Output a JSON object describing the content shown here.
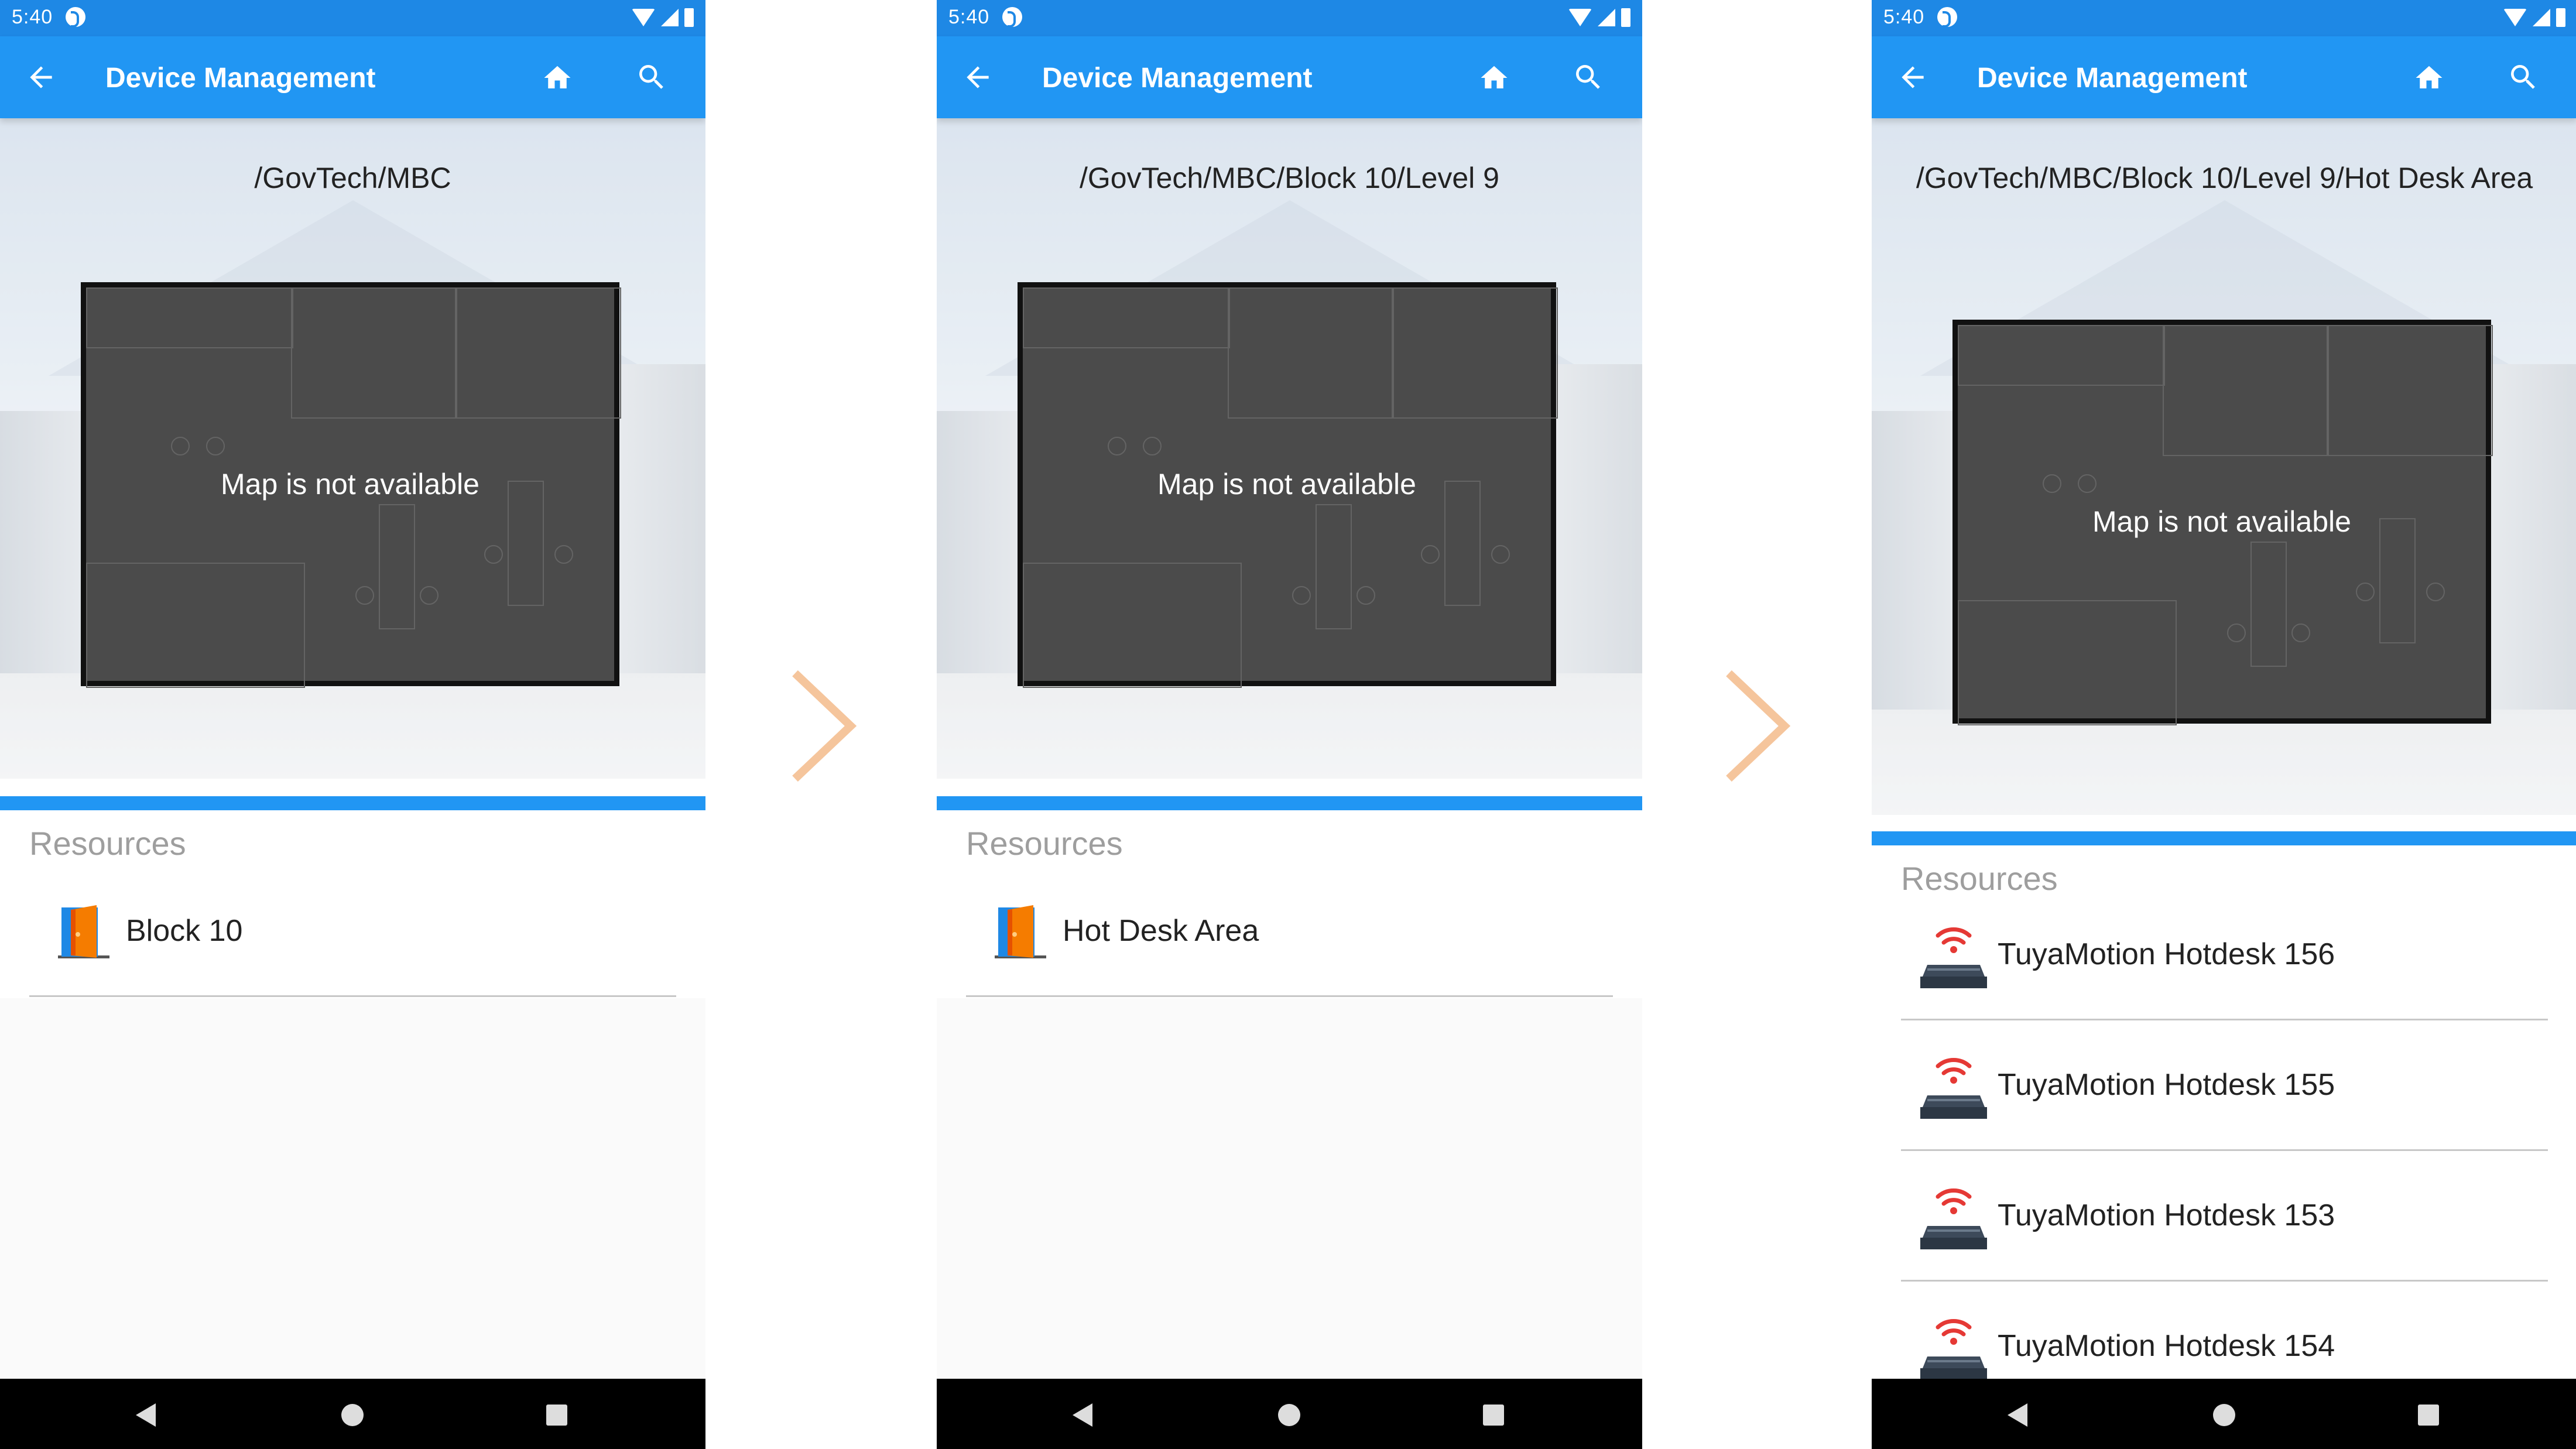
{
  "status_bar": {
    "time": "5:40"
  },
  "app_bar": {
    "title": "Device Management"
  },
  "screens": [
    {
      "breadcrumb": "/GovTech/MBC",
      "map_message": "Map is not available",
      "resources_heading": "Resources",
      "resources": [
        {
          "label": "Block 10",
          "icon": "door-icon"
        }
      ]
    },
    {
      "breadcrumb": "/GovTech/MBC/Block 10/Level 9",
      "map_message": "Map is not available",
      "resources_heading": "Resources",
      "resources": [
        {
          "label": "Hot Desk Area",
          "icon": "door-icon"
        }
      ]
    },
    {
      "breadcrumb": "/GovTech/MBC/Block 10/Level 9/Hot Desk Area",
      "map_message": "Map is not available",
      "resources_heading": "Resources",
      "resources": [
        {
          "label": "TuyaMotion Hotdesk 156",
          "icon": "motion-sensor-icon"
        },
        {
          "label": "TuyaMotion Hotdesk 155",
          "icon": "motion-sensor-icon"
        },
        {
          "label": "TuyaMotion Hotdesk 153",
          "icon": "motion-sensor-icon"
        },
        {
          "label": "TuyaMotion Hotdesk 154",
          "icon": "motion-sensor-icon"
        }
      ]
    }
  ],
  "colors": {
    "app_bar": "#2196f3",
    "status_bar": "#1e88e5",
    "chevron": "#f5c59c",
    "map_background": "#4b4b4b"
  }
}
